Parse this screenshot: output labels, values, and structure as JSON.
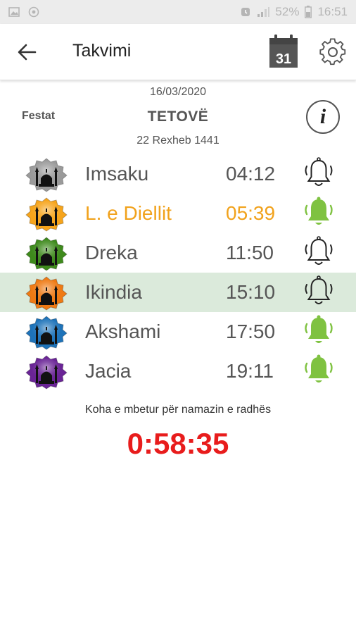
{
  "status_bar": {
    "battery": "52%",
    "time": "16:51",
    "left_icons": [
      "image-icon",
      "cast-icon"
    ],
    "right_icons": [
      "alarm-icon",
      "signal-icon",
      "battery-icon"
    ]
  },
  "toolbar": {
    "back_icon": "arrow-left-icon",
    "title": "Takvimi",
    "calendar_day": "31",
    "settings_icon": "gear-icon"
  },
  "header": {
    "date": "16/03/2020",
    "festat_label": "Festat",
    "city": "TETOVË",
    "hijri_date": "22 Rexheb 1441",
    "info_glyph": "i"
  },
  "prayers": [
    {
      "name": "Imsaku",
      "time": "04:12",
      "icon_color": "#9a9a9a",
      "alarm_on": false,
      "highlight": false,
      "current": false
    },
    {
      "name": "L. e Diellit",
      "time": "05:39",
      "icon_color": "#f6a41b",
      "alarm_on": true,
      "highlight": true,
      "current": false
    },
    {
      "name": "Dreka",
      "time": "11:50",
      "icon_color": "#3e8a1c",
      "alarm_on": false,
      "highlight": false,
      "current": false
    },
    {
      "name": "Ikindia",
      "time": "15:10",
      "icon_color": "#ef7a14",
      "alarm_on": false,
      "highlight": false,
      "current": true
    },
    {
      "name": "Akshami",
      "time": "17:50",
      "icon_color": "#1e73b9",
      "alarm_on": true,
      "highlight": false,
      "current": false
    },
    {
      "name": "Jacia",
      "time": "19:11",
      "icon_color": "#6a2496",
      "alarm_on": true,
      "highlight": false,
      "current": false
    }
  ],
  "countdown": {
    "label": "Koha e mbetur për namazin e radhës",
    "value": "0:58:35"
  },
  "colors": {
    "alarm_on": "#7fc241",
    "alarm_off": "#222222",
    "highlight_text": "#f1a21c",
    "current_row": "#dbeadb",
    "countdown": "#e81c1c"
  }
}
